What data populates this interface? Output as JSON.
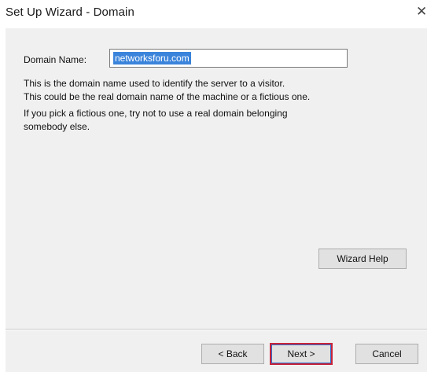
{
  "window": {
    "title": "Set Up Wizard - Domain",
    "close_glyph": "✕"
  },
  "form": {
    "domain_label": "Domain Name:",
    "domain_value": "networksforu.com"
  },
  "description": {
    "line1": "This is the domain name used to identify the server to a visitor.",
    "line2": "This could be the real domain name of the machine or a fictious one.",
    "line3": "If you pick a fictious one, try not to use a real domain belonging",
    "line4": "somebody else."
  },
  "buttons": {
    "help": "Wizard Help",
    "back": "< Back",
    "next": "Next >",
    "cancel": "Cancel"
  },
  "colors": {
    "selection": "#3b84db",
    "dialog_bg": "#f0f0f0",
    "highlight_border": "#c8243a"
  }
}
